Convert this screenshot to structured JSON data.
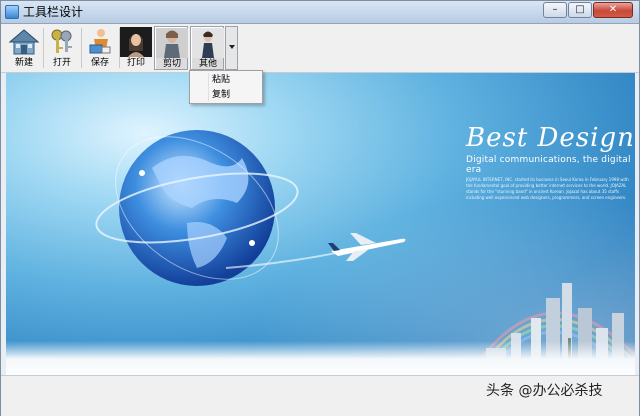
{
  "window": {
    "title": "工具栏设计",
    "buttons": {
      "minimize": "–",
      "maximize": "□",
      "close": "✕"
    }
  },
  "toolbar": {
    "items": [
      {
        "label": "新建",
        "icon": "house-icon"
      },
      {
        "label": "打开",
        "icon": "keys-icon"
      },
      {
        "label": "保存",
        "icon": "figure-save-icon"
      },
      {
        "label": "打印",
        "icon": "portrait-print-icon"
      },
      {
        "label": "剪切",
        "icon": "portrait-cut-icon"
      },
      {
        "label": "其他",
        "icon": "portrait-other-icon"
      }
    ]
  },
  "dropdown_menu": {
    "items": [
      "粘贴",
      "复制"
    ]
  },
  "banner": {
    "title": "Best Design",
    "subtitle": "Digital communications, the digital era",
    "fine_print": "JOJAYUL INTERNET, INC. started its business in Seoul Korea in February 1998 with the fundamental goal of providing better internet services to the world. JOJAZAL stands for the \"stunning band\" in ancient Korean. Jojazal has about 35 staffs including well experienced web designers, programmers, and screen engineers."
  },
  "watermark": "头条 @办公必杀技"
}
